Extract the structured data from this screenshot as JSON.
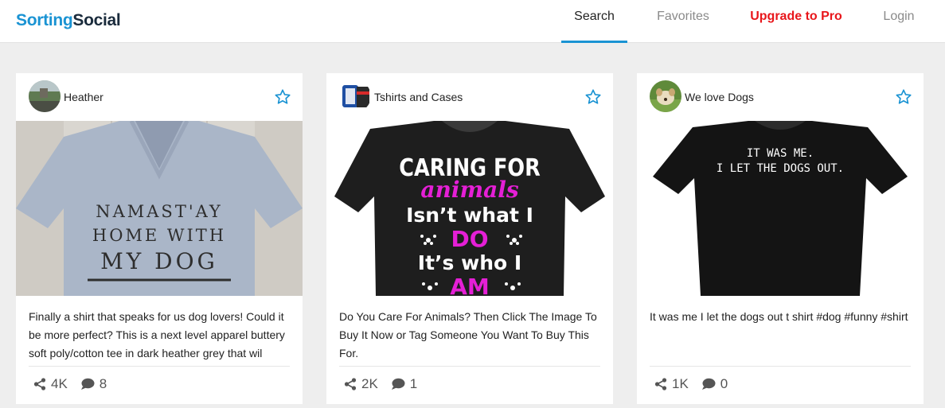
{
  "logo": {
    "part1": "Sorting",
    "part2": "Social"
  },
  "nav": {
    "search": "Search",
    "favorites": "Favorites",
    "upgrade": "Upgrade to Pro",
    "login": "Login"
  },
  "cards": [
    {
      "author": "Heather",
      "image": {
        "lines": [
          "NAMAST'AY",
          "HOME WITH",
          "MY DOG"
        ]
      },
      "text": "Finally a shirt that speaks for us dog lovers! Could it be more perfect? This is a next level apparel buttery soft poly/cotton tee in dark heather grey that wil",
      "shares": "4K",
      "comments": "8"
    },
    {
      "author": "Tshirts and Cases",
      "image": {
        "lines": [
          "CARING FOR",
          "animals",
          "Isn’t what I",
          "DO",
          "It’s who I",
          "AM"
        ]
      },
      "text": "Do You Care For Animals? Then Click The Image To Buy It Now or Tag Someone You Want To Buy This For.",
      "shares": "2K",
      "comments": "1"
    },
    {
      "author": "We love Dogs",
      "image": {
        "lines": [
          "IT WAS ME.",
          "I LET THE DOGS OUT."
        ]
      },
      "text": "It was me I let the dogs out t shirt #dog #funny #shirt",
      "shares": "1K",
      "comments": "0"
    }
  ],
  "colors": {
    "brand_blue": "#1a93d3",
    "pro_red": "#e8161b",
    "magenta": "#e51fd6"
  }
}
